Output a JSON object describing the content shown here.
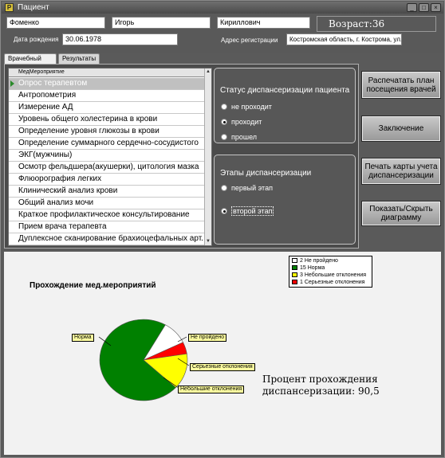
{
  "window": {
    "title": "Пациент",
    "app_icon": "app-icon",
    "controls": [
      "minimize-icon",
      "maximize-icon",
      "close-icon"
    ]
  },
  "patient": {
    "last_name": "Фоменко",
    "first_name": "Игорь",
    "middle_name": "Кириллович",
    "age_label": "Возраст:",
    "age_value": "36",
    "birth_date_label": "Дата рождения",
    "birth_date": "30.06.1978",
    "address_label": "Адрес регистрации",
    "address": "Костромская область, г. Кострома, ул. Ос"
  },
  "tabs": [
    {
      "label": "Врачебный план",
      "active": true
    },
    {
      "label": "Результаты",
      "active": false
    }
  ],
  "procedures": {
    "column_header": "МедМероприятие",
    "items": [
      "Опрос терапевтом",
      "Антропометрия",
      "Измерение АД",
      "Уровень общего холестерина в крови",
      "Определение уровня глюкозы в крови",
      "Определение суммарного сердечно-сосудистого",
      "ЭКГ(мужчины)",
      "Осмотр фельдшера(акушерки), цитология мазка",
      "Флюорография легких",
      "Клинический анализ крови",
      "Общий анализ мочи",
      "Краткое профилактическое консультирование",
      "Прием врача терапевта",
      "Дуплексное сканирование брахиоцефальных арт."
    ],
    "selected_index": 0
  },
  "status_group": {
    "title": "Статус диспансеризации пациента",
    "options": [
      "не проходит",
      "проходит",
      "прошел"
    ],
    "selected_index": 1
  },
  "stage_group": {
    "title": "Этапы диспансеризации",
    "options": [
      "первый этап",
      "второй этап"
    ],
    "selected_index": 1
  },
  "buttons": {
    "print_plan": "Распечатать план посещения врачей",
    "conclusion": "Заключение",
    "print_card": "Печать карты учета диспансеризации",
    "toggle_chart": "Показать/Скрыть диаграмму"
  },
  "chart_data": {
    "type": "pie",
    "title": "Прохождение мед.мероприятий",
    "legend_position": "top-right",
    "categories": [
      "Не пройдено",
      "Норма",
      "Небольшие отклонения",
      "Серьезные отклонения"
    ],
    "values": [
      2,
      15,
      3,
      1
    ],
    "legend_labels": [
      "2 Не пройдено",
      "15 Норма",
      "3 Небольшие отклонения",
      "1 Серьезные отклонения"
    ],
    "callouts": [
      "Норма",
      "Не пройдено",
      "Серьезные отклонения",
      "Небольшие отклонения"
    ],
    "colors": [
      "#ffffff",
      "#008000",
      "#ffff00",
      "#ff0000"
    ],
    "annotation_line1": "Процент прохождения",
    "annotation_line2": "диспансеризации: 90,5"
  }
}
